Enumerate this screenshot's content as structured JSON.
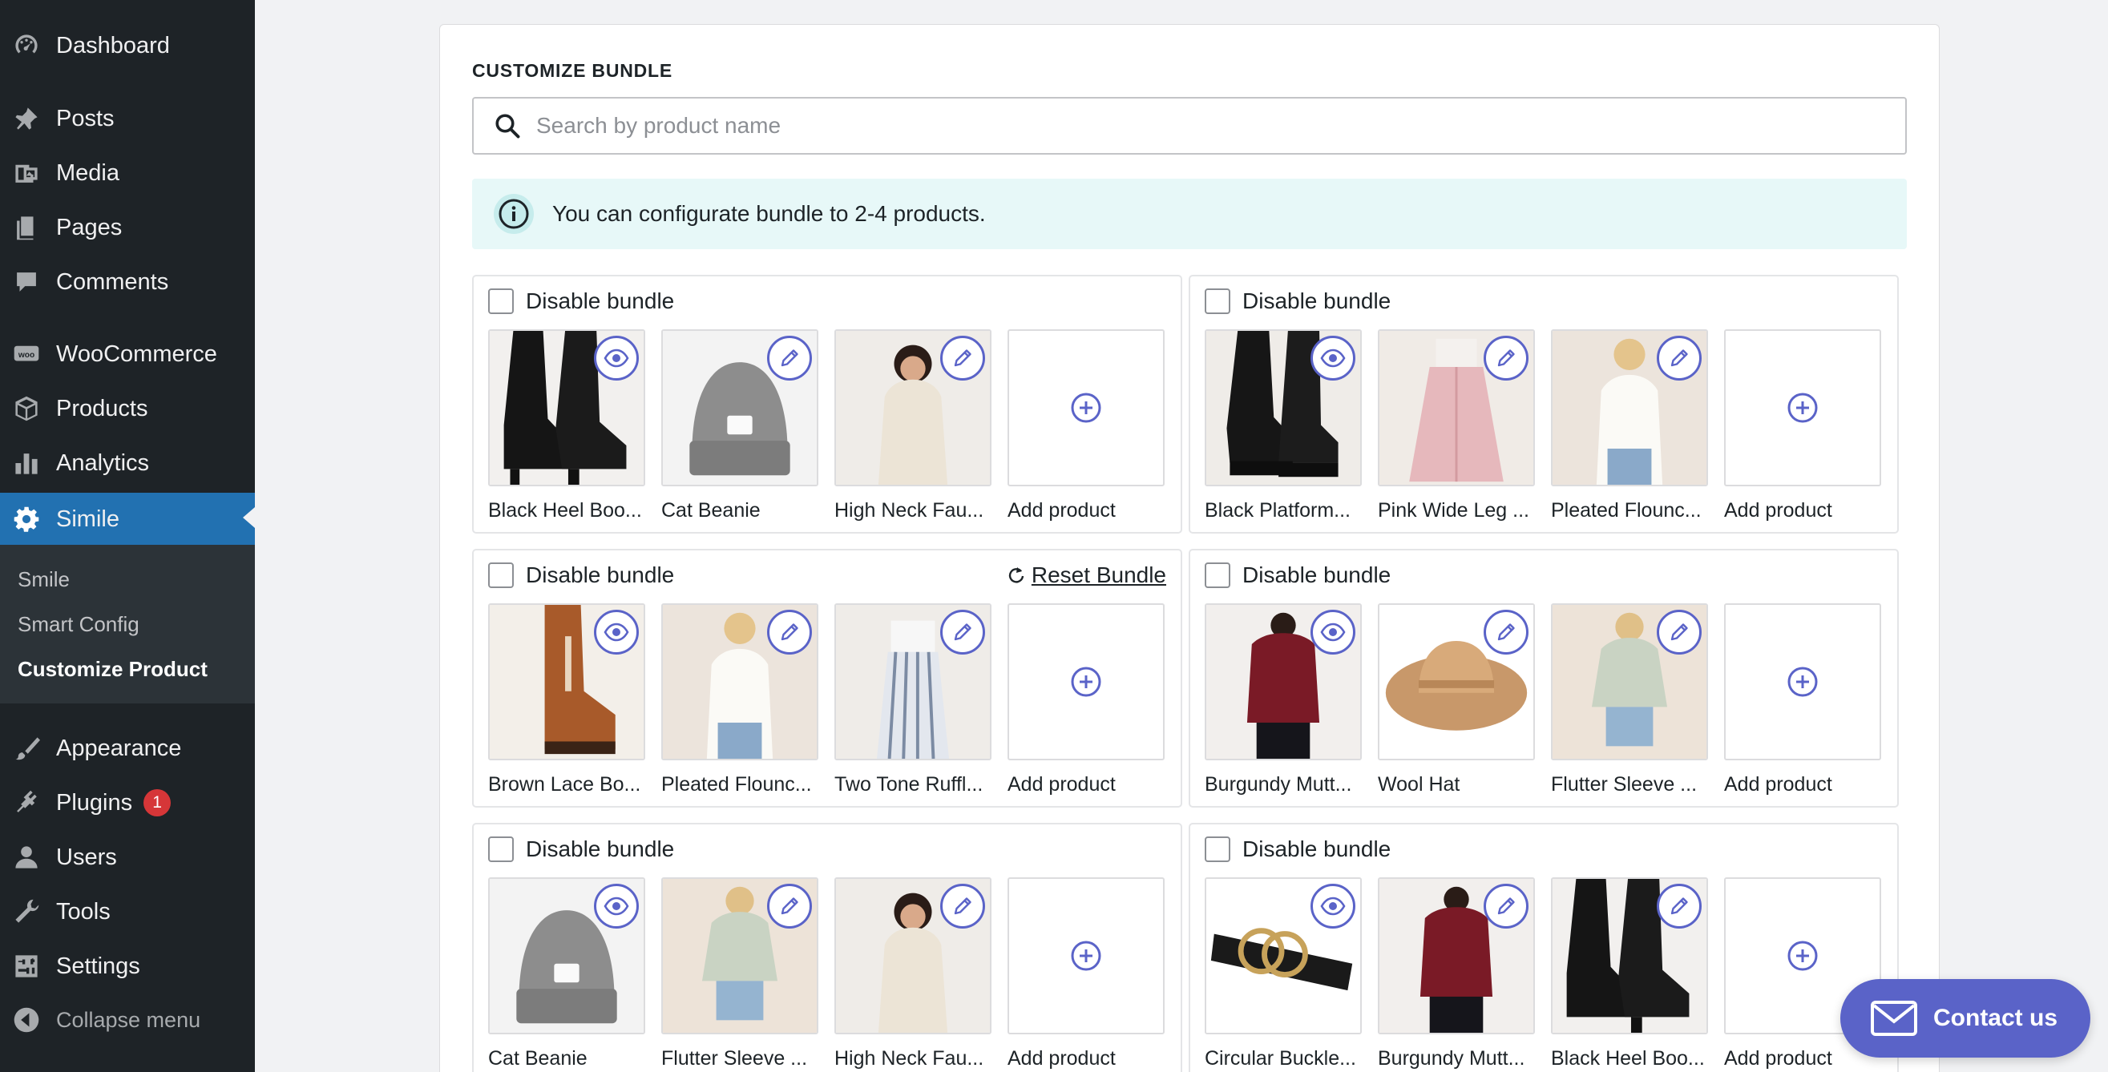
{
  "sidebar": {
    "items": [
      {
        "label": "Dashboard",
        "icon": "dashboard-icon"
      },
      {
        "label": "Posts",
        "icon": "pin-icon"
      },
      {
        "label": "Media",
        "icon": "media-icon"
      },
      {
        "label": "Pages",
        "icon": "pages-icon"
      },
      {
        "label": "Comments",
        "icon": "comment-icon"
      },
      {
        "label": "WooCommerce",
        "icon": "woo-icon"
      },
      {
        "label": "Products",
        "icon": "box-icon"
      },
      {
        "label": "Analytics",
        "icon": "bar-chart-icon"
      },
      {
        "label": "Simile",
        "icon": "gear-icon",
        "active": true
      },
      {
        "label": "Appearance",
        "icon": "brush-icon"
      },
      {
        "label": "Plugins",
        "icon": "plug-icon",
        "badge": "1"
      },
      {
        "label": "Users",
        "icon": "user-icon"
      },
      {
        "label": "Tools",
        "icon": "wrench-icon"
      },
      {
        "label": "Settings",
        "icon": "settings-icon"
      }
    ],
    "submenu": [
      {
        "label": "Smile"
      },
      {
        "label": "Smart Config"
      },
      {
        "label": "Customize Product",
        "current": true
      }
    ],
    "collapse_label": "Collapse menu"
  },
  "panel": {
    "title": "CUSTOMIZE BUNDLE",
    "search_placeholder": "Search by product name",
    "notice": "You can configurate bundle to 2-4 products."
  },
  "bundles": [
    {
      "disable_label": "Disable bundle",
      "products": [
        {
          "name": "Black Heel Boo...",
          "action": "eye-icon"
        },
        {
          "name": "Cat Beanie",
          "action": "pencil-icon"
        },
        {
          "name": "High Neck Fau...",
          "action": "pencil-icon"
        },
        {
          "name": "Add product",
          "action": "add"
        }
      ]
    },
    {
      "disable_label": "Disable bundle",
      "products": [
        {
          "name": "Black Platform...",
          "action": "eye-icon"
        },
        {
          "name": "Pink Wide Leg ...",
          "action": "pencil-icon"
        },
        {
          "name": "Pleated Flounc...",
          "action": "pencil-icon"
        },
        {
          "name": "Add product",
          "action": "add"
        }
      ]
    },
    {
      "disable_label": "Disable bundle",
      "reset_label": "Reset Bundle",
      "products": [
        {
          "name": "Brown Lace Bo...",
          "action": "eye-icon"
        },
        {
          "name": "Pleated Flounc...",
          "action": "pencil-icon"
        },
        {
          "name": "Two Tone Ruffl...",
          "action": "pencil-icon"
        },
        {
          "name": "Add product",
          "action": "add"
        }
      ]
    },
    {
      "disable_label": "Disable bundle",
      "products": [
        {
          "name": "Burgundy Mutt...",
          "action": "eye-icon"
        },
        {
          "name": "Wool Hat",
          "action": "pencil-icon"
        },
        {
          "name": "Flutter Sleeve ...",
          "action": "pencil-icon"
        },
        {
          "name": "Add product",
          "action": "add"
        }
      ]
    },
    {
      "disable_label": "Disable bundle",
      "products": [
        {
          "name": "Cat Beanie",
          "action": "eye-icon"
        },
        {
          "name": "Flutter Sleeve ...",
          "action": "pencil-icon"
        },
        {
          "name": "High Neck Fau...",
          "action": "pencil-icon"
        },
        {
          "name": "Add product",
          "action": "add"
        }
      ]
    },
    {
      "disable_label": "Disable bundle",
      "products": [
        {
          "name": "Circular Buckle...",
          "action": "eye-icon"
        },
        {
          "name": "Burgundy Mutt...",
          "action": "pencil-icon"
        },
        {
          "name": "Black Heel Boo...",
          "action": "pencil-icon"
        },
        {
          "name": "Add product",
          "action": "add"
        }
      ]
    }
  ],
  "contact_label": "Contact us",
  "colors": {
    "sidebar_bg": "#1e2327",
    "submenu_bg": "#2c3338",
    "active_bg": "#2271b1",
    "accent": "#5a63c8",
    "notice_bg": "#e7f8f8",
    "badge": "#d63638"
  }
}
